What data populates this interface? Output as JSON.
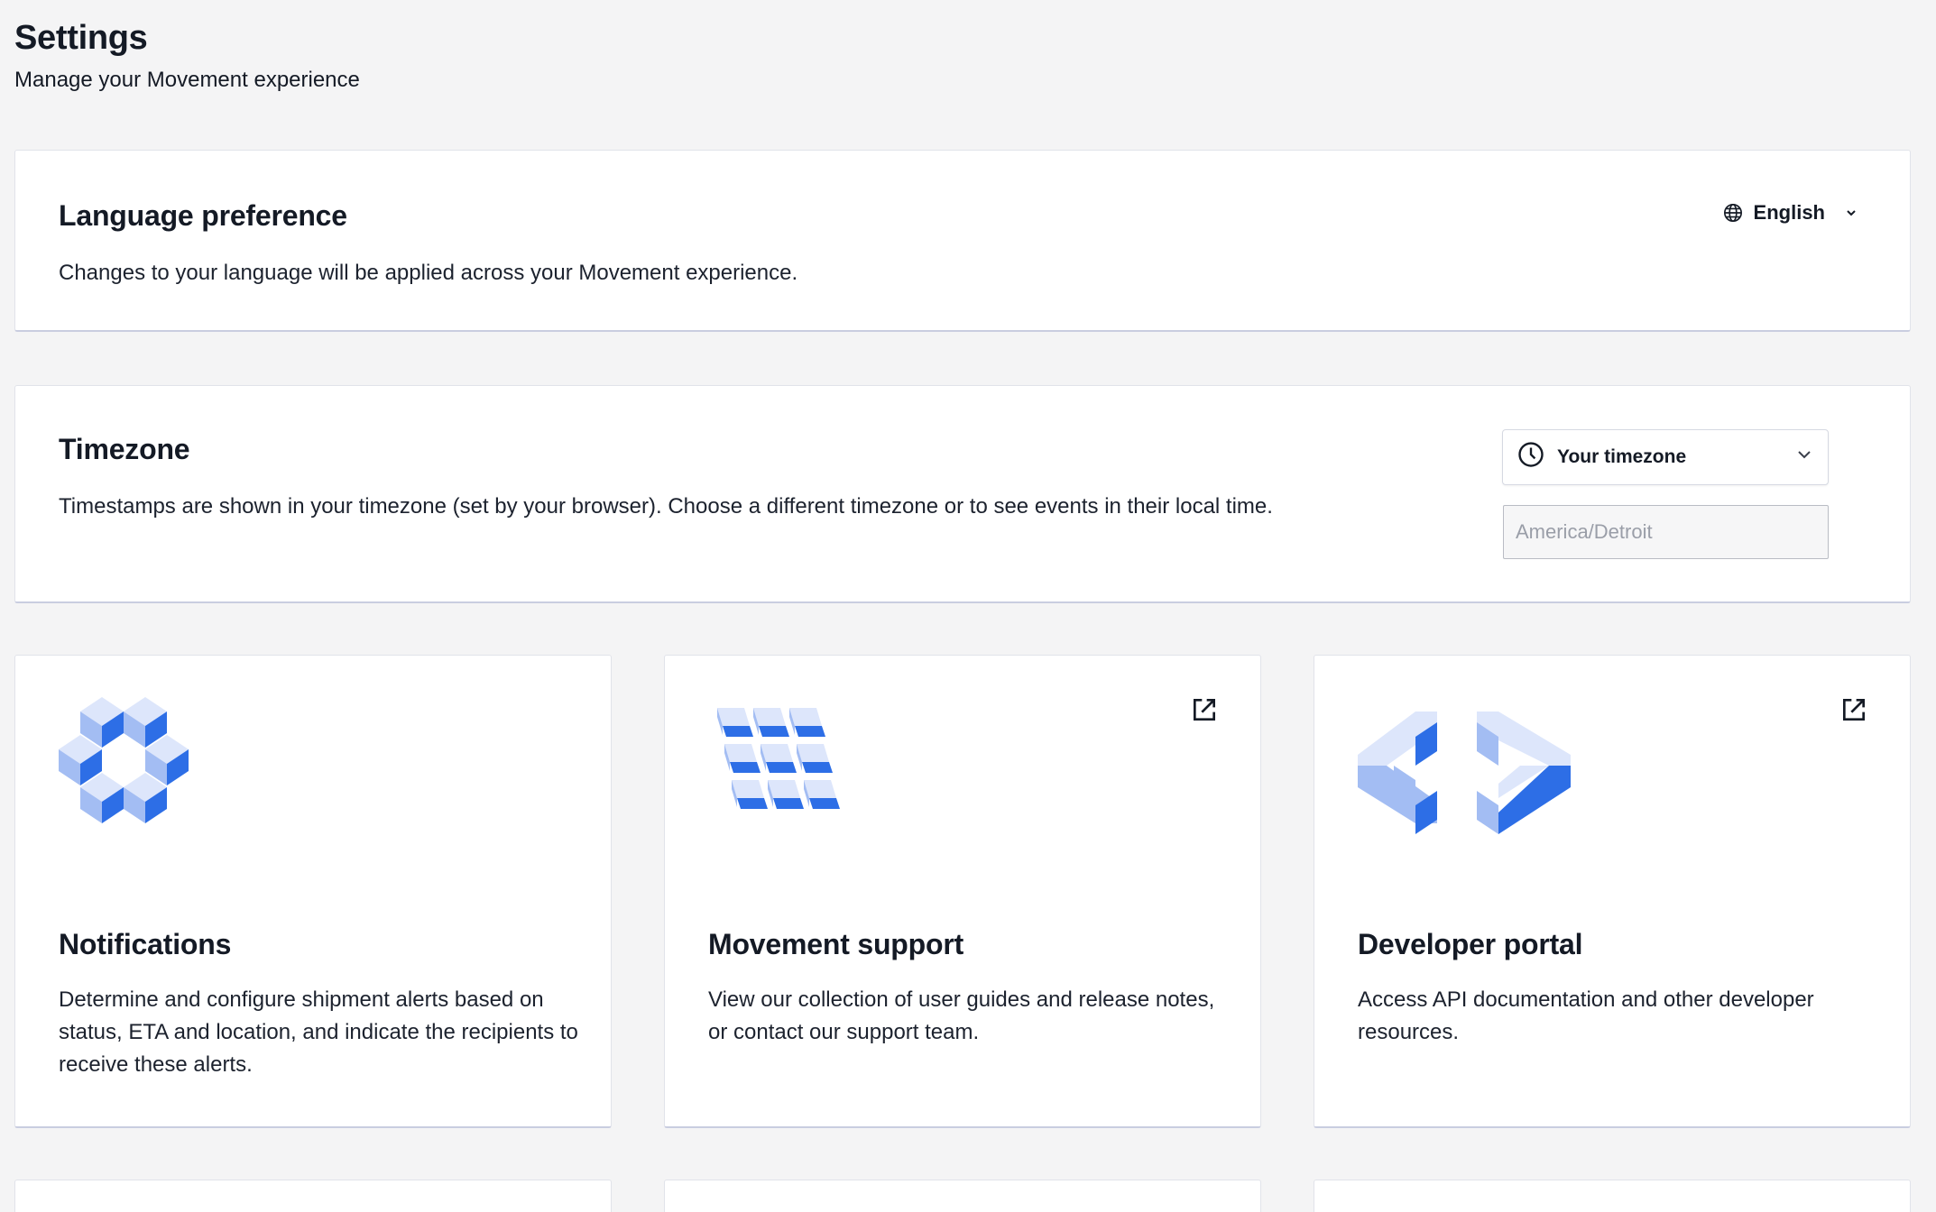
{
  "header": {
    "title": "Settings",
    "subtitle": "Manage your Movement experience"
  },
  "language": {
    "title": "Language preference",
    "description": "Changes to your language will be applied across your Movement experience.",
    "selected": "English",
    "icon": "globe-icon"
  },
  "timezone": {
    "title": "Timezone",
    "description": "Timestamps are shown in your timezone (set by your browser). Choose a different timezone or to see events in their local time.",
    "selected": "Your timezone",
    "input_placeholder": "America/Detroit",
    "icon": "clock-icon"
  },
  "cards": {
    "notifications": {
      "title": "Notifications",
      "description": "Determine and configure shipment alerts based on status, ETA and location, and indicate the recipients to receive these alerts."
    },
    "support": {
      "title": "Movement support",
      "description": "View our collection of user guides and release notes, or contact our support team."
    },
    "developer": {
      "title": "Developer portal",
      "description": "Access API documentation and other developer resources."
    }
  },
  "colors": {
    "accent_dark": "#2d6ee6",
    "accent_mid": "#a3bdf3",
    "accent_light": "#dde6fb",
    "background": "#f4f4f5"
  }
}
